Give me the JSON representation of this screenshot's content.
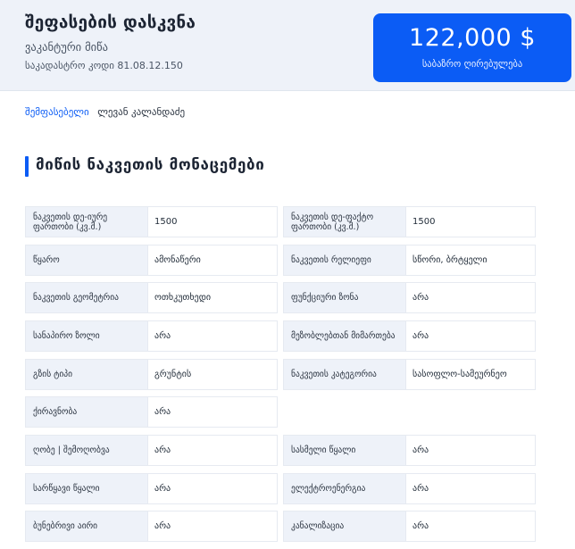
{
  "header": {
    "title": "შეფასების დასკვნა",
    "property_type": "ვაკანტური მიწა",
    "cadastral_code": "საკადასტრო კოდი 81.08.12.150"
  },
  "valuation": {
    "amount": "122,000 $",
    "label": "საბაზრო ღირებულება"
  },
  "appraiser": {
    "link_label": "შემფასებელი",
    "name": "ლევან კალანდაძე"
  },
  "section": {
    "title": "მიწის ნაკვეთის მონაცემები"
  },
  "rows": [
    [
      {
        "label": "ნაკვეთის დე-იურე ფართობი (კვ.მ.)",
        "value": "1500"
      },
      {
        "label": "ნაკვეთის დე-ფაქტო ფართობი (კვ.მ.)",
        "value": "1500"
      }
    ],
    [
      {
        "label": "წყარო",
        "value": "ამონაწერი"
      },
      {
        "label": "ნაკვეთის რელიეფი",
        "value": "სწორი, ბრტყელი"
      }
    ],
    [
      {
        "label": "ნაკვეთის გეომეტრია",
        "value": "ოთხკუთხედი"
      },
      {
        "label": "ფუნქციური ზონა",
        "value": "არა"
      }
    ],
    [
      {
        "label": "სანაპირო ზოლი",
        "value": "არა"
      },
      {
        "label": "მეზობლებთან მიმართება",
        "value": "არა"
      }
    ],
    [
      {
        "label": "გზის ტიპი",
        "value": "გრუნტის"
      },
      {
        "label": "ნაკვეთის კატეგორია",
        "value": "სასოფლო-სამეურნეო"
      }
    ],
    [
      {
        "label": "ქირავნობა",
        "value": "არა"
      }
    ],
    [
      {
        "label": "ღობე | შემოღობვა",
        "value": "არა"
      },
      {
        "label": "სასმელი წყალი",
        "value": "არა"
      }
    ],
    [
      {
        "label": "სარწყავი წყალი",
        "value": "არა"
      },
      {
        "label": "ელექტროენერგია",
        "value": "არა"
      }
    ],
    [
      {
        "label": "ბუნებრივი აირი",
        "value": "არა"
      },
      {
        "label": "კანალიზაცია",
        "value": "არა"
      }
    ]
  ]
}
